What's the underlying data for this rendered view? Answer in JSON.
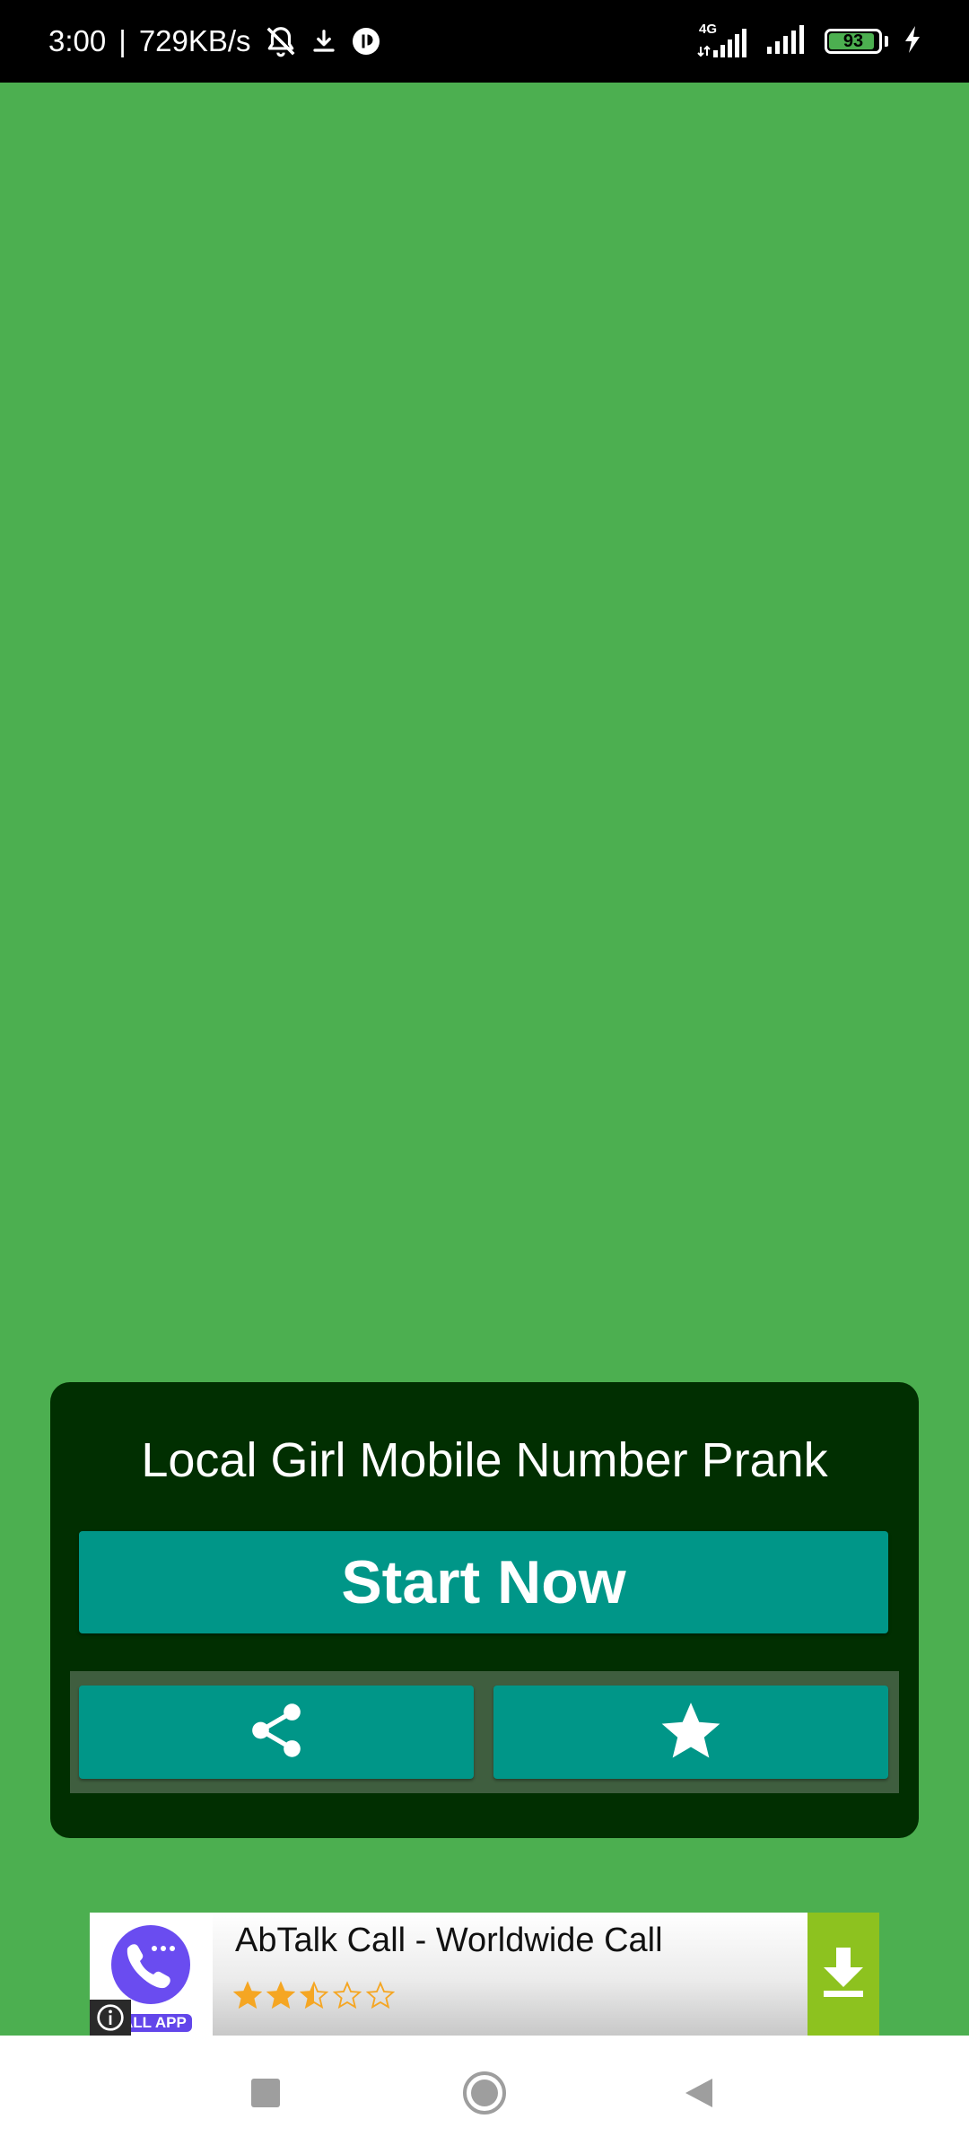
{
  "status_bar": {
    "time": "3:00",
    "separator": "|",
    "net_speed": "729KB/s",
    "icons": [
      "bell-off-icon",
      "download-icon",
      "app-notification-icon",
      "signal-4g-icon",
      "signal-icon",
      "battery-icon",
      "charging-icon"
    ],
    "network_type": "4G",
    "battery_percent": 93
  },
  "card": {
    "title": "Local Girl Mobile Number Prank",
    "start_button_label": "Start Now",
    "share_button_icon": "share-icon",
    "rate_button_icon": "star-icon"
  },
  "ad": {
    "app_name": "AbTalk Call - Worldwide Call",
    "icon_badge": "ALL APP",
    "rating": 2.5,
    "rating_max": 5,
    "info_icon": "info-icon",
    "download_icon": "download-arrow-icon"
  },
  "nav_bar": {
    "buttons": [
      "recents-icon",
      "home-icon",
      "back-icon"
    ]
  },
  "colors": {
    "background": "#4caf50",
    "card": "#012f01",
    "button": "#009688",
    "button_row": "#3f5e3f",
    "ad_download": "#8dc21f",
    "star": "#f5a623"
  }
}
